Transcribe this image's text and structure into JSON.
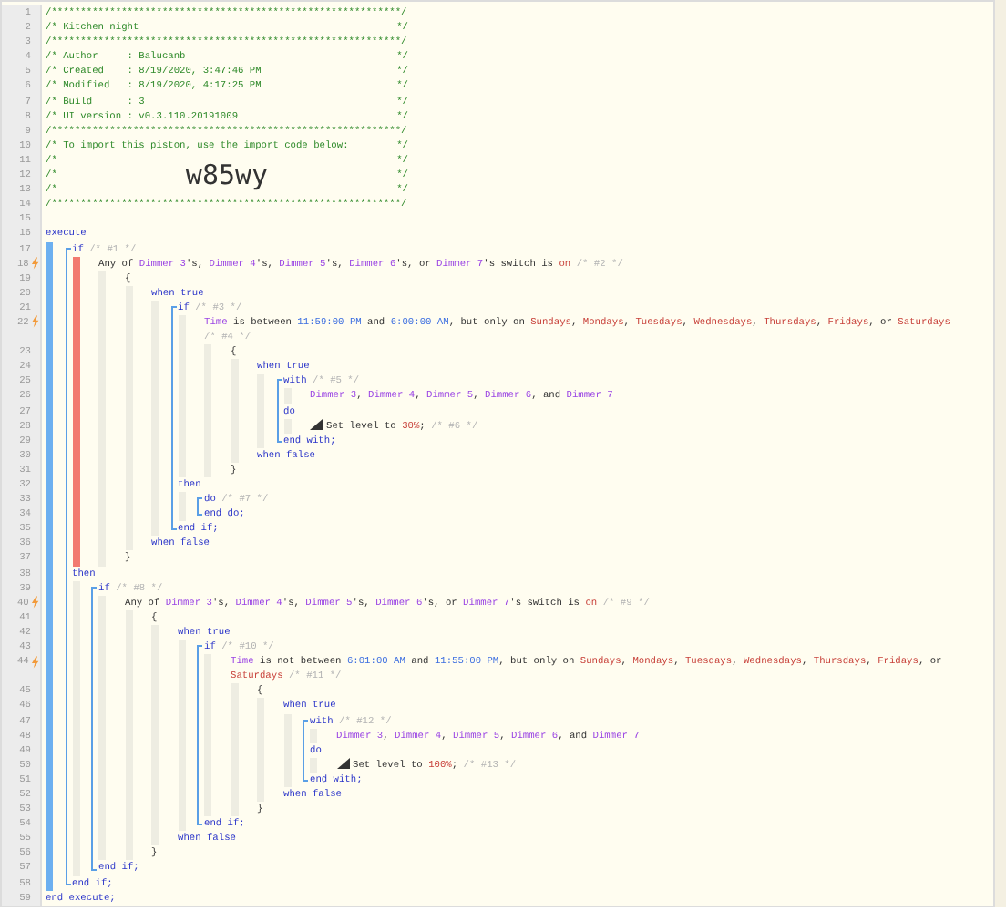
{
  "header": [
    {
      "number": "1",
      "text": "/************************************************************/"
    },
    {
      "number": "2",
      "text": "/* Kitchen night",
      "close": "*/"
    },
    {
      "number": "3",
      "text": "/************************************************************/"
    },
    {
      "number": "4",
      "text": "/* Author     : Balucanb",
      "close": "*/"
    },
    {
      "number": "5",
      "text": "/* Created    : 8/19/2020, 3:47:46 PM",
      "close": "*/"
    },
    {
      "number": "6",
      "text": "/* Modified   : 8/19/2020, 4:17:25 PM",
      "close": "*/"
    },
    {
      "number": "7",
      "text": "/* Build      : 3",
      "close": "*/"
    },
    {
      "number": "8",
      "text": "/* UI version : v0.3.110.20191009",
      "close": "*/"
    },
    {
      "number": "9",
      "text": "/************************************************************/"
    },
    {
      "number": "10",
      "text": "/* To import this piston, use the import code below:",
      "close": "*/"
    },
    {
      "number": "11",
      "text": "/*",
      "close": "*/"
    },
    {
      "number": "12",
      "text": "/*",
      "code": "w85wy",
      "close": "*/"
    },
    {
      "number": "13",
      "text": "/*",
      "close": "*/"
    },
    {
      "number": "14",
      "text": "/************************************************************/"
    },
    {
      "number": "15"
    }
  ],
  "program": [
    {
      "number": "16",
      "kind": "execute",
      "trigger": false,
      "highlighted": false,
      "tokens": [
        {
          "kind": "keyword",
          "text": "execute"
        }
      ],
      "children": [
        {
          "number": "17",
          "kind": "statement",
          "trigger": false,
          "highlighted": true,
          "tokens": [
            {
              "kind": "keyword",
              "text": "if"
            },
            {
              "kind": "comment",
              "text": " /* #1 */"
            }
          ],
          "children": [
            {
              "number": "18",
              "kind": "line",
              "trigger": true,
              "highlighted": false,
              "tokens": [
                {
                  "kind": "text",
                  "text": "Any of "
                },
                {
                  "kind": "device",
                  "text": "Dimmer 3"
                },
                {
                  "kind": "text",
                  "text": "'s, "
                },
                {
                  "kind": "device",
                  "text": "Dimmer 4"
                },
                {
                  "kind": "text",
                  "text": "'s, "
                },
                {
                  "kind": "device",
                  "text": "Dimmer 5"
                },
                {
                  "kind": "text",
                  "text": "'s, "
                },
                {
                  "kind": "device",
                  "text": "Dimmer 6"
                },
                {
                  "kind": "text",
                  "text": "'s, or "
                },
                {
                  "kind": "device",
                  "text": "Dimmer 7"
                },
                {
                  "kind": "text",
                  "text": "'s switch is "
                },
                {
                  "kind": "value",
                  "text": "on"
                },
                {
                  "kind": "comment",
                  "text": " /* #2 */"
                }
              ],
              "children": [
                {
                  "number": "19",
                  "kind": "line",
                  "trigger": false,
                  "highlighted": false,
                  "tokens": [
                    {
                      "kind": "text",
                      "text": "{"
                    }
                  ],
                  "children": [
                    {
                      "number": "20",
                      "kind": "line",
                      "trigger": false,
                      "highlighted": false,
                      "tokens": [
                        {
                          "kind": "keyword",
                          "text": "when true"
                        }
                      ],
                      "children": [
                        {
                          "number": "21",
                          "kind": "statement",
                          "trigger": false,
                          "highlighted": false,
                          "tokens": [
                            {
                              "kind": "keyword",
                              "text": "if"
                            },
                            {
                              "kind": "comment",
                              "text": " /* #3 */"
                            }
                          ],
                          "children": [
                            {
                              "number": "22",
                              "kind": "line",
                              "trigger": true,
                              "highlighted": false,
                              "tokens": [
                                {
                                  "kind": "device",
                                  "text": "Time"
                                },
                                {
                                  "kind": "text",
                                  "text": " is between "
                                },
                                {
                                  "kind": "time",
                                  "text": "11:59:00 PM"
                                },
                                {
                                  "kind": "text",
                                  "text": " and "
                                },
                                {
                                  "kind": "time",
                                  "text": "6:00:00 AM"
                                },
                                {
                                  "kind": "text",
                                  "text": ", but only on "
                                },
                                {
                                  "kind": "value",
                                  "text": "Sundays"
                                },
                                {
                                  "kind": "text",
                                  "text": ", "
                                },
                                {
                                  "kind": "value",
                                  "text": "Mondays"
                                },
                                {
                                  "kind": "text",
                                  "text": ", "
                                },
                                {
                                  "kind": "value",
                                  "text": "Tuesdays"
                                },
                                {
                                  "kind": "text",
                                  "text": ", "
                                },
                                {
                                  "kind": "value",
                                  "text": "Wednesdays"
                                },
                                {
                                  "kind": "text",
                                  "text": ", "
                                },
                                {
                                  "kind": "value",
                                  "text": "Thursdays"
                                },
                                {
                                  "kind": "text",
                                  "text": ", "
                                },
                                {
                                  "kind": "value",
                                  "text": "Fridays"
                                },
                                {
                                  "kind": "text",
                                  "text": ", or "
                                },
                                {
                                  "kind": "value",
                                  "text": "Saturdays"
                                },
                                {
                                  "kind": "comment",
                                  "text": " /* #4 */"
                                }
                              ],
                              "children": [
                                {
                                  "number": "23",
                                  "kind": "line",
                                  "trigger": false,
                                  "highlighted": false,
                                  "tokens": [
                                    {
                                      "kind": "text",
                                      "text": "{"
                                    }
                                  ],
                                  "children": [
                                    {
                                      "number": "24",
                                      "kind": "line",
                                      "trigger": false,
                                      "highlighted": false,
                                      "tokens": [
                                        {
                                          "kind": "keyword",
                                          "text": "when true"
                                        }
                                      ],
                                      "children": [
                                        {
                                          "number": "25",
                                          "kind": "statement",
                                          "trigger": false,
                                          "highlighted": false,
                                          "tokens": [
                                            {
                                              "kind": "keyword",
                                              "text": "with"
                                            },
                                            {
                                              "kind": "comment",
                                              "text": " /* #5 */"
                                            }
                                          ],
                                          "children": [
                                            {
                                              "number": "26",
                                              "kind": "line",
                                              "trigger": false,
                                              "tokens": [
                                                {
                                                  "kind": "device",
                                                  "text": "Dimmer 3"
                                                },
                                                {
                                                  "kind": "text",
                                                  "text": ", "
                                                },
                                                {
                                                  "kind": "device",
                                                  "text": "Dimmer 4"
                                                },
                                                {
                                                  "kind": "text",
                                                  "text": ", "
                                                },
                                                {
                                                  "kind": "device",
                                                  "text": "Dimmer 5"
                                                },
                                                {
                                                  "kind": "text",
                                                  "text": ", "
                                                },
                                                {
                                                  "kind": "device",
                                                  "text": "Dimmer 6"
                                                },
                                                {
                                                  "kind": "text",
                                                  "text": ", and "
                                                },
                                                {
                                                  "kind": "device",
                                                  "text": "Dimmer 7"
                                                }
                                              ]
                                            }
                                          ]
                                        },
                                        {
                                          "number": "27",
                                          "kind": "line",
                                          "trigger": false,
                                          "highlighted": false,
                                          "tokens": [
                                            {
                                              "kind": "keyword",
                                              "text": "do"
                                            }
                                          ],
                                          "children": [
                                            {
                                              "number": "28",
                                              "kind": "command",
                                              "trigger": false,
                                              "tokens": [
                                                {
                                                  "kind": "text",
                                                  "text": "Set level to "
                                                },
                                                {
                                                  "kind": "value",
                                                  "text": "30%"
                                                },
                                                {
                                                  "kind": "text",
                                                  "text": "; "
                                                },
                                                {
                                                  "kind": "comment",
                                                  "text": "/* #6 */"
                                                }
                                              ]
                                            }
                                          ]
                                        },
                                        {
                                          "number": "29",
                                          "kind": "end",
                                          "trigger": false,
                                          "tokens": [
                                            {
                                              "kind": "keyword",
                                              "text": "end with;"
                                            }
                                          ]
                                        }
                                      ]
                                    },
                                    {
                                      "number": "30",
                                      "kind": "line",
                                      "trigger": false,
                                      "tokens": [
                                        {
                                          "kind": "keyword",
                                          "text": "when false"
                                        }
                                      ]
                                    }
                                  ]
                                },
                                {
                                  "number": "31",
                                  "kind": "line",
                                  "trigger": false,
                                  "tokens": [
                                    {
                                      "kind": "text",
                                      "text": "}"
                                    }
                                  ]
                                }
                              ]
                            }
                          ]
                        },
                        {
                          "number": "32",
                          "kind": "line",
                          "trigger": false,
                          "highlighted": false,
                          "tokens": [
                            {
                              "kind": "keyword",
                              "text": "then"
                            }
                          ],
                          "children": [
                            {
                              "number": "33",
                              "kind": "statement",
                              "trigger": false,
                              "tokens": [
                                {
                                  "kind": "keyword",
                                  "text": "do"
                                },
                                {
                                  "kind": "comment",
                                  "text": " /* #7 */"
                                }
                              ]
                            },
                            {
                              "number": "34",
                              "kind": "end",
                              "trigger": false,
                              "tokens": [
                                {
                                  "kind": "keyword",
                                  "text": "end do;"
                                }
                              ]
                            }
                          ]
                        },
                        {
                          "number": "35",
                          "kind": "end",
                          "trigger": false,
                          "tokens": [
                            {
                              "kind": "keyword",
                              "text": "end if;"
                            }
                          ]
                        }
                      ]
                    },
                    {
                      "number": "36",
                      "kind": "line",
                      "trigger": false,
                      "tokens": [
                        {
                          "kind": "keyword",
                          "text": "when false"
                        }
                      ]
                    }
                  ]
                },
                {
                  "number": "37",
                  "kind": "line",
                  "trigger": false,
                  "tokens": [
                    {
                      "kind": "text",
                      "text": "}"
                    }
                  ]
                }
              ]
            }
          ]
        },
        {
          "number": "38",
          "kind": "line",
          "trigger": false,
          "highlighted": false,
          "tokens": [
            {
              "kind": "keyword",
              "text": "then"
            }
          ],
          "children": [
            {
              "number": "39",
              "kind": "statement",
              "trigger": false,
              "highlighted": false,
              "tokens": [
                {
                  "kind": "keyword",
                  "text": "if"
                },
                {
                  "kind": "comment",
                  "text": " /* #8 */"
                }
              ],
              "children": [
                {
                  "number": "40",
                  "kind": "line",
                  "trigger": true,
                  "highlighted": false,
                  "tokens": [
                    {
                      "kind": "text",
                      "text": "Any of "
                    },
                    {
                      "kind": "device",
                      "text": "Dimmer 3"
                    },
                    {
                      "kind": "text",
                      "text": "'s, "
                    },
                    {
                      "kind": "device",
                      "text": "Dimmer 4"
                    },
                    {
                      "kind": "text",
                      "text": "'s, "
                    },
                    {
                      "kind": "device",
                      "text": "Dimmer 5"
                    },
                    {
                      "kind": "text",
                      "text": "'s, "
                    },
                    {
                      "kind": "device",
                      "text": "Dimmer 6"
                    },
                    {
                      "kind": "text",
                      "text": "'s, or "
                    },
                    {
                      "kind": "device",
                      "text": "Dimmer 7"
                    },
                    {
                      "kind": "text",
                      "text": "'s switch is "
                    },
                    {
                      "kind": "value",
                      "text": "on"
                    },
                    {
                      "kind": "comment",
                      "text": " /* #9 */"
                    }
                  ],
                  "children": [
                    {
                      "number": "41",
                      "kind": "line",
                      "trigger": false,
                      "highlighted": false,
                      "tokens": [
                        {
                          "kind": "text",
                          "text": "{"
                        }
                      ],
                      "children": [
                        {
                          "number": "42",
                          "kind": "line",
                          "trigger": false,
                          "highlighted": false,
                          "tokens": [
                            {
                              "kind": "keyword",
                              "text": "when true"
                            }
                          ],
                          "children": [
                            {
                              "number": "43",
                              "kind": "statement",
                              "trigger": false,
                              "highlighted": false,
                              "tokens": [
                                {
                                  "kind": "keyword",
                                  "text": "if"
                                },
                                {
                                  "kind": "comment",
                                  "text": " /* #10 */"
                                }
                              ],
                              "children": [
                                {
                                  "number": "44",
                                  "kind": "line",
                                  "trigger": true,
                                  "highlighted": false,
                                  "tokens": [
                                    {
                                      "kind": "device",
                                      "text": "Time"
                                    },
                                    {
                                      "kind": "text",
                                      "text": " is not between "
                                    },
                                    {
                                      "kind": "time",
                                      "text": "6:01:00 AM"
                                    },
                                    {
                                      "kind": "text",
                                      "text": " and "
                                    },
                                    {
                                      "kind": "time",
                                      "text": "11:55:00 PM"
                                    },
                                    {
                                      "kind": "text",
                                      "text": ", but only on "
                                    },
                                    {
                                      "kind": "value",
                                      "text": "Sundays"
                                    },
                                    {
                                      "kind": "text",
                                      "text": ", "
                                    },
                                    {
                                      "kind": "value",
                                      "text": "Mondays"
                                    },
                                    {
                                      "kind": "text",
                                      "text": ", "
                                    },
                                    {
                                      "kind": "value",
                                      "text": "Tuesdays"
                                    },
                                    {
                                      "kind": "text",
                                      "text": ", "
                                    },
                                    {
                                      "kind": "value",
                                      "text": "Wednesdays"
                                    },
                                    {
                                      "kind": "text",
                                      "text": ", "
                                    },
                                    {
                                      "kind": "value",
                                      "text": "Thursdays"
                                    },
                                    {
                                      "kind": "text",
                                      "text": ", "
                                    },
                                    {
                                      "kind": "value",
                                      "text": "Fridays"
                                    },
                                    {
                                      "kind": "text",
                                      "text": ", or "
                                    },
                                    {
                                      "kind": "value",
                                      "text": "Saturdays"
                                    },
                                    {
                                      "kind": "comment",
                                      "text": " /* #11 */"
                                    }
                                  ],
                                  "children": [
                                    {
                                      "number": "45",
                                      "kind": "line",
                                      "trigger": false,
                                      "highlighted": false,
                                      "tokens": [
                                        {
                                          "kind": "text",
                                          "text": "{"
                                        }
                                      ],
                                      "children": [
                                        {
                                          "number": "46",
                                          "kind": "line",
                                          "trigger": false,
                                          "highlighted": false,
                                          "tokens": [
                                            {
                                              "kind": "keyword",
                                              "text": "when true"
                                            }
                                          ],
                                          "children": [
                                            {
                                              "number": "47",
                                              "kind": "statement",
                                              "trigger": false,
                                              "highlighted": false,
                                              "tokens": [
                                                {
                                                  "kind": "keyword",
                                                  "text": "with"
                                                },
                                                {
                                                  "kind": "comment",
                                                  "text": " /* #12 */"
                                                }
                                              ],
                                              "children": [
                                                {
                                                  "number": "48",
                                                  "kind": "line",
                                                  "trigger": false,
                                                  "tokens": [
                                                    {
                                                      "kind": "device",
                                                      "text": "Dimmer 3"
                                                    },
                                                    {
                                                      "kind": "text",
                                                      "text": ", "
                                                    },
                                                    {
                                                      "kind": "device",
                                                      "text": "Dimmer 4"
                                                    },
                                                    {
                                                      "kind": "text",
                                                      "text": ", "
                                                    },
                                                    {
                                                      "kind": "device",
                                                      "text": "Dimmer 5"
                                                    },
                                                    {
                                                      "kind": "text",
                                                      "text": ", "
                                                    },
                                                    {
                                                      "kind": "device",
                                                      "text": "Dimmer 6"
                                                    },
                                                    {
                                                      "kind": "text",
                                                      "text": ", and "
                                                    },
                                                    {
                                                      "kind": "device",
                                                      "text": "Dimmer 7"
                                                    }
                                                  ]
                                                }
                                              ]
                                            },
                                            {
                                              "number": "49",
                                              "kind": "line",
                                              "trigger": false,
                                              "highlighted": false,
                                              "tokens": [
                                                {
                                                  "kind": "keyword",
                                                  "text": "do"
                                                }
                                              ],
                                              "children": [
                                                {
                                                  "number": "50",
                                                  "kind": "command",
                                                  "trigger": false,
                                                  "tokens": [
                                                    {
                                                      "kind": "text",
                                                      "text": "Set level to "
                                                    },
                                                    {
                                                      "kind": "value",
                                                      "text": "100%"
                                                    },
                                                    {
                                                      "kind": "text",
                                                      "text": "; "
                                                    },
                                                    {
                                                      "kind": "comment",
                                                      "text": "/* #13 */"
                                                    }
                                                  ]
                                                }
                                              ]
                                            },
                                            {
                                              "number": "51",
                                              "kind": "end",
                                              "trigger": false,
                                              "tokens": [
                                                {
                                                  "kind": "keyword",
                                                  "text": "end with;"
                                                }
                                              ]
                                            }
                                          ]
                                        },
                                        {
                                          "number": "52",
                                          "kind": "line",
                                          "trigger": false,
                                          "tokens": [
                                            {
                                              "kind": "keyword",
                                              "text": "when false"
                                            }
                                          ]
                                        }
                                      ]
                                    },
                                    {
                                      "number": "53",
                                      "kind": "line",
                                      "trigger": false,
                                      "tokens": [
                                        {
                                          "kind": "text",
                                          "text": "}"
                                        }
                                      ]
                                    }
                                  ]
                                }
                              ]
                            },
                            {
                              "number": "54",
                              "kind": "end",
                              "trigger": false,
                              "tokens": [
                                {
                                  "kind": "keyword",
                                  "text": "end if;"
                                }
                              ]
                            }
                          ]
                        },
                        {
                          "number": "55",
                          "kind": "line",
                          "trigger": false,
                          "tokens": [
                            {
                              "kind": "keyword",
                              "text": "when false"
                            }
                          ]
                        }
                      ]
                    },
                    {
                      "number": "56",
                      "kind": "line",
                      "trigger": false,
                      "tokens": [
                        {
                          "kind": "text",
                          "text": "}"
                        }
                      ]
                    }
                  ]
                }
              ]
            },
            {
              "number": "57",
              "kind": "end",
              "trigger": false,
              "tokens": [
                {
                  "kind": "keyword",
                  "text": "end if;"
                }
              ]
            }
          ]
        },
        {
          "number": "58",
          "kind": "end",
          "trigger": false,
          "tokens": [
            {
              "kind": "keyword",
              "text": "end if;"
            }
          ]
        }
      ]
    },
    {
      "number": "59",
      "kind": "line",
      "trigger": false,
      "tokens": [
        {
          "kind": "keyword",
          "text": "end execute;"
        }
      ]
    }
  ]
}
